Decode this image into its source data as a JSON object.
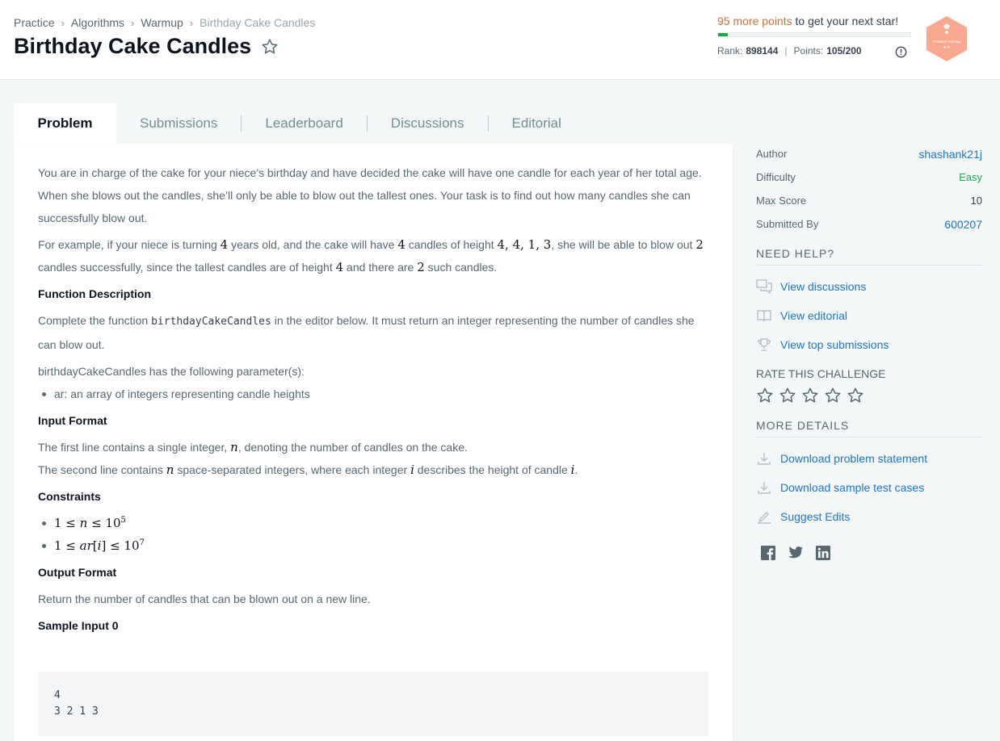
{
  "breadcrumb": [
    {
      "label": "Practice"
    },
    {
      "label": "Algorithms"
    },
    {
      "label": "Warmup"
    },
    {
      "label": "Birthday Cake Candles"
    }
  ],
  "title": "Birthday Cake Candles",
  "progress": {
    "points_needed": "95 more points",
    "suffix": " to get your next star!",
    "fraction": 0.05,
    "rank_label": "Rank:",
    "rank_value": "898144",
    "points_label": "Points:",
    "points_value": "105/200",
    "fill_color": "#1ba94c"
  },
  "badge": {
    "text": "Problem Solving",
    "stars": "★★",
    "color": "#f7a88e"
  },
  "tabs": [
    {
      "label": "Problem",
      "active": true
    },
    {
      "label": "Submissions"
    },
    {
      "label": "Leaderboard"
    },
    {
      "label": "Discussions"
    },
    {
      "label": "Editorial"
    }
  ],
  "problem": {
    "intro": "You are in charge of the cake for your niece's birthday and have decided the cake will have one candle for each year of her total age. When she blows out the candles, she’ll only be able to blow out the tallest ones. Your task is to find out how many candles she can successfully blow out.",
    "example": {
      "t1": "For example, if your niece is turning ",
      "m1": "4",
      "t2": " years old, and the cake will have ",
      "m2": "4",
      "t3": " candles of height ",
      "m3": "4, 4, 1, 3",
      "t4": ", she will be able to blow out ",
      "m4": "2",
      "t5": " candles successfully, since the tallest candles are of height ",
      "m5": "4",
      "t6": " and there are ",
      "m6": "2",
      "t7": " such candles."
    },
    "function_description_heading": "Function Description",
    "fd_t1": "Complete the function ",
    "fd_code": "birthdayCakeCandles",
    "fd_t2": " in the editor below. It must return an integer representing the number of candles she can blow out.",
    "params_intro": "birthdayCakeCandles has the following parameter(s):",
    "params": [
      "ar: an array of integers representing candle heights"
    ],
    "input_format_heading": "Input Format",
    "input_l1_a": "The first line contains a single integer, ",
    "input_l1_m": "n",
    "input_l1_b": ", denoting the number of candles on the cake.",
    "input_l2_a": "The second line contains ",
    "input_l2_m1": "n",
    "input_l2_b": " space-separated integers, where each integer ",
    "input_l2_m2": "i",
    "input_l2_c": " describes the height of candle ",
    "input_l2_m3": "i",
    "input_l2_d": ".",
    "constraints_heading": "Constraints",
    "c1_a": "1 ≤ ",
    "c1_var": "n",
    "c1_b": " ≤ 10",
    "c1_exp": "5",
    "c2_a": "1 ≤ ",
    "c2_var": "ar",
    "c2_b": "[",
    "c2_idx": "i",
    "c2_c": "] ≤ 10",
    "c2_exp": "7",
    "output_format_heading": "Output Format",
    "output_text": "Return the number of candles that can be blown out on a new line.",
    "sample_input_heading": "Sample Input 0",
    "sample_input": "4\n3 2 1 3"
  },
  "sidebar": {
    "meta": [
      {
        "label": "Author",
        "value": "shashank21j",
        "style": "link"
      },
      {
        "label": "Difficulty",
        "value": "Easy",
        "style": "easy"
      },
      {
        "label": "Max Score",
        "value": "10",
        "style": "plain"
      },
      {
        "label": "Submitted By",
        "value": "600207",
        "style": "link"
      }
    ],
    "need_help": "NEED HELP?",
    "help_links": [
      {
        "label": "View discussions",
        "icon": "discussion-icon"
      },
      {
        "label": "View editorial",
        "icon": "book-icon"
      },
      {
        "label": "View top submissions",
        "icon": "trophy-icon"
      }
    ],
    "rate_title": "RATE THIS CHALLENGE",
    "rating_stars": 5,
    "more_details": "MORE DETAILS",
    "detail_links": [
      {
        "label": "Download problem statement",
        "icon": "download-icon"
      },
      {
        "label": "Download sample test cases",
        "icon": "download-icon"
      },
      {
        "label": "Suggest Edits",
        "icon": "pencil-icon"
      }
    ],
    "social": [
      "facebook-icon",
      "twitter-icon",
      "linkedin-icon"
    ]
  }
}
